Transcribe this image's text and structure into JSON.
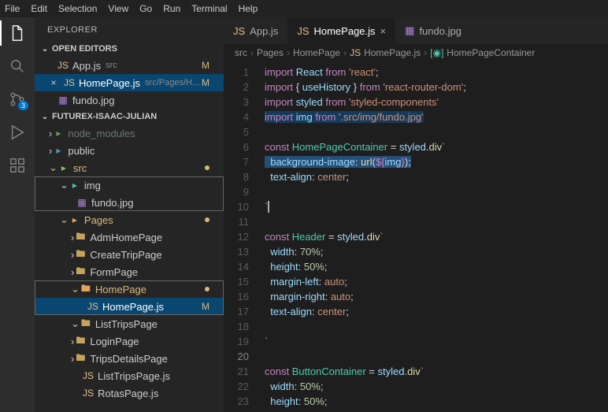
{
  "menu": {
    "file": "File",
    "edit": "Edit",
    "selection": "Selection",
    "view": "View",
    "go": "Go",
    "run": "Run",
    "terminal": "Terminal",
    "help": "Help"
  },
  "activity": {
    "scm_badge": "3"
  },
  "sidebar": {
    "title": "EXPLORER",
    "open_editors_label": "OPEN EDITORS",
    "workspace_label": "FUTUREX-ISAAC-JULIAN",
    "open_editors": [
      {
        "icon": "JS",
        "name": "App.js",
        "meta": "src",
        "mark": "M"
      },
      {
        "icon": "JS",
        "name": "HomePage.js",
        "meta": "src/Pages/H...",
        "mark": "M",
        "close": "×"
      },
      {
        "icon": "img",
        "name": "fundo.jpg",
        "meta": "",
        "mark": ""
      }
    ],
    "tree": {
      "node_modules": "node_modules",
      "public": "public",
      "src": "src",
      "img": "img",
      "fundo": "fundo.jpg",
      "pages": "Pages",
      "adm": "AdmHomePage",
      "create": "CreateTripPage",
      "form": "FormPage",
      "home": "HomePage",
      "home_js": "HomePage.js",
      "home_mark": "M",
      "list": "ListTripsPage",
      "login": "LoginPage",
      "trips": "TripsDetailsPage",
      "list_js": "ListTripsPage.js",
      "rotas_js": "RotasPage.js"
    }
  },
  "tabs": [
    {
      "icon": "JS",
      "label": "App.js"
    },
    {
      "icon": "JS",
      "label": "HomePage.js",
      "active": true
    },
    {
      "icon": "img",
      "label": "fundo.jpg"
    }
  ],
  "breadcrumb": {
    "p1": "src",
    "p2": "Pages",
    "p3": "HomePage",
    "p4": "HomePage.js",
    "p5": "HomePageContainer"
  },
  "code": {
    "l1": {
      "a": "import",
      "b": "React",
      "c": "from",
      "d": "'react'",
      "e": ";"
    },
    "l2": {
      "a": "import",
      "b": "{ ",
      "c": "useHistory",
      "d": " }",
      "e": "from",
      "f": "'react-router-dom'",
      "g": ";"
    },
    "l3": {
      "a": "import",
      "b": "styled",
      "c": "from",
      "d": "'styled-components'"
    },
    "l4": {
      "a": "import",
      "b": "img",
      "c": "from",
      "d": "'.src/img/fundo.jpg'"
    },
    "l6": {
      "a": "const",
      "b": "HomePageContainer",
      "c": " = ",
      "d": "styled",
      "e": ".",
      "f": "div",
      "g": "`"
    },
    "l7": {
      "a": "  background-image",
      "b": ": ",
      "c": "url",
      "d": "(",
      "e": "${",
      "f": "img",
      "g": "}",
      "h": ")",
      "i": ";"
    },
    "l8": {
      "a": "  text-align",
      "b": ": ",
      "c": "center",
      "d": ";"
    },
    "l10": {
      "a": "`"
    },
    "l12": {
      "a": "const",
      "b": "Header",
      "c": " = ",
      "d": "styled",
      "e": ".",
      "f": "div",
      "g": "`"
    },
    "l13": {
      "a": "  width",
      "b": ": ",
      "c": "70%",
      "d": ";"
    },
    "l14": {
      "a": "  height",
      "b": ": ",
      "c": "50%",
      "d": ";"
    },
    "l15": {
      "a": "  margin-left",
      "b": ": ",
      "c": "auto",
      "d": ";"
    },
    "l16": {
      "a": "  margin-right",
      "b": ": ",
      "c": "auto",
      "d": ";"
    },
    "l17": {
      "a": "  text-align",
      "b": ": ",
      "c": "center",
      "d": ";"
    },
    "l19": {
      "a": "`"
    },
    "l21": {
      "a": "const",
      "b": "ButtonContainer",
      "c": " = ",
      "d": "styled",
      "e": ".",
      "f": "div",
      "g": "`"
    },
    "l22": {
      "a": "  width",
      "b": ": ",
      "c": "50%",
      "d": ";"
    },
    "l23": {
      "a": "  height",
      "b": ": ",
      "c": "50%",
      "d": ";"
    }
  }
}
